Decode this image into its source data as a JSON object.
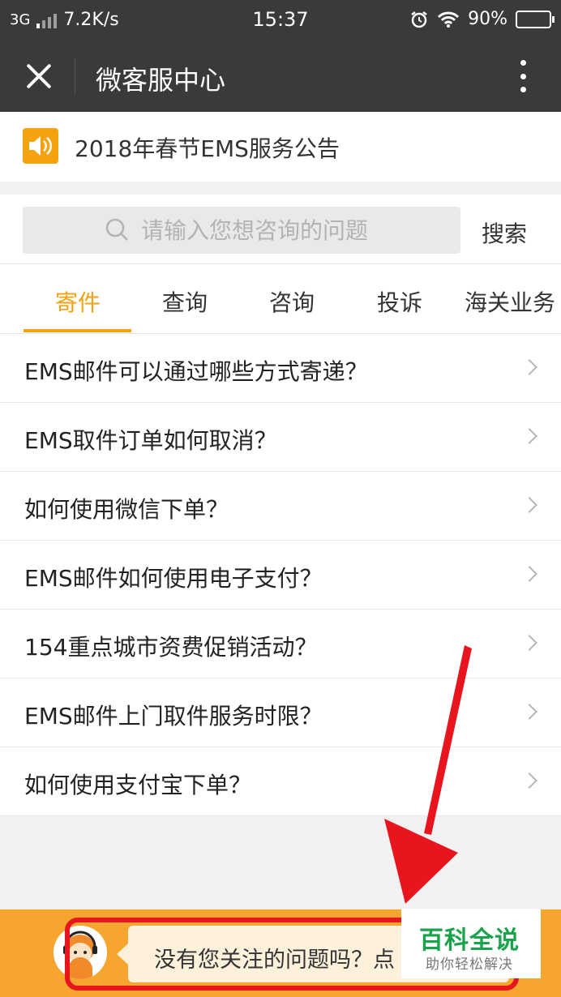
{
  "status_bar": {
    "network": "3G",
    "speed": "7.2K/s",
    "time": "15:37",
    "battery": "90%",
    "battery_level": 0.9
  },
  "nav": {
    "title": "微客服中心"
  },
  "notice": {
    "text": "2018年春节EMS服务公告"
  },
  "search": {
    "placeholder": "请输入您想咨询的问题",
    "button": "搜索"
  },
  "tabs": [
    "寄件",
    "查询",
    "咨询",
    "投诉",
    "海关业务"
  ],
  "active_tab": "寄件",
  "questions": [
    "EMS邮件可以通过哪些方式寄递？",
    "EMS取件订单如何取消？",
    "如何使用微信下单？",
    "EMS邮件如何使用电子支付？",
    "154重点城市资费促销活动？",
    "EMS邮件上门取件服务时限？",
    "如何使用支付宝下单？"
  ],
  "bottom": {
    "prompt": "没有您关注的问题吗？点"
  },
  "watermark": {
    "title": "百科全说",
    "subtitle": "助你轻松解决"
  },
  "colors": {
    "accent": "#f4a20f",
    "bar": "#3a3a3c",
    "highlight": "#e8141e",
    "watermark": "#19a34a"
  }
}
